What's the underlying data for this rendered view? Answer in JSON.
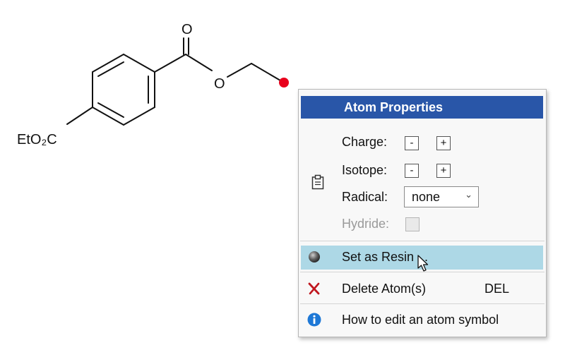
{
  "molecule": {
    "atom_labels": {
      "carbonyl_oxygen": "O",
      "ester_oxygen": "O",
      "ester_group": "EtO₂C"
    },
    "selected_atom_color": "#e8001c"
  },
  "context_menu": {
    "title": "Atom Properties",
    "header_color": "#2956a8",
    "properties": {
      "charge_label": "Charge:",
      "isotope_label": "Isotope:",
      "radical_label": "Radical:",
      "hydride_label": "Hydride:",
      "minus": "-",
      "plus": "+",
      "radical_value": "none",
      "hydride_checked": false,
      "hydride_enabled": false,
      "icon": "clipboard-icon"
    },
    "items": [
      {
        "label": "Set as Resin ...",
        "icon": "sphere-icon",
        "shortcut": "",
        "highlighted": true
      },
      {
        "label": "Delete Atom(s)",
        "icon": "red-x-icon",
        "shortcut": "DEL",
        "highlighted": false
      },
      {
        "label": "How to edit an atom symbol",
        "icon": "info-icon",
        "shortcut": "",
        "highlighted": false
      }
    ],
    "highlight_color": "#add8e6"
  }
}
